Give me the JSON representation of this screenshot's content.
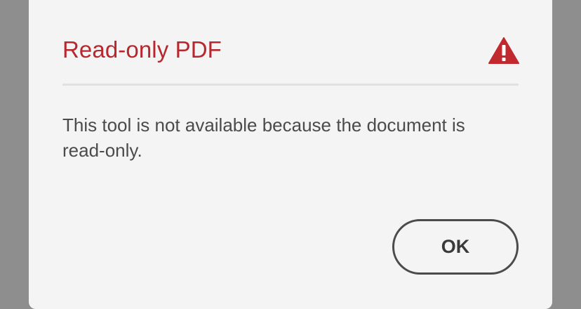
{
  "dialog": {
    "title": "Read-only PDF",
    "message": "This tool is not available because the document is read-only.",
    "ok_label": "OK",
    "icon": "warning-icon"
  },
  "colors": {
    "title": "#b7282e",
    "icon": "#c1292e",
    "backdrop": "#8e8e8e",
    "dialog_background": "#f4f4f4"
  }
}
